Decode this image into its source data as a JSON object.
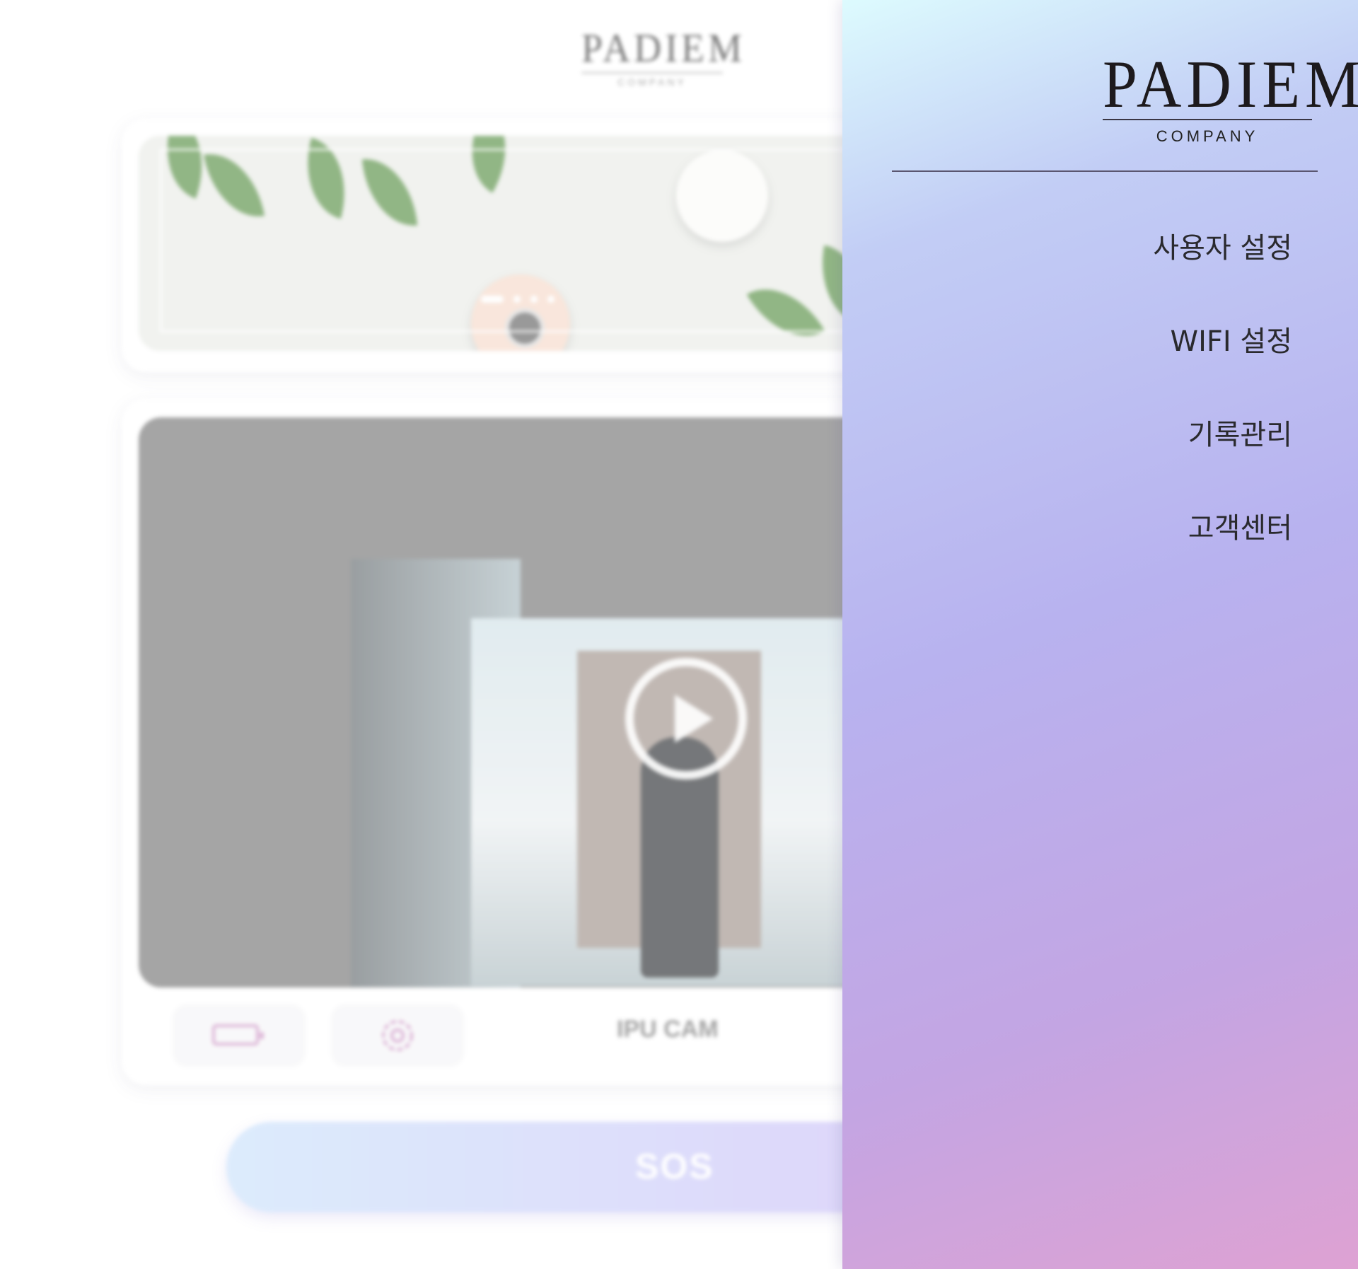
{
  "app": {
    "logo": {
      "name": "PADIEM",
      "subtitle": "COMPANY"
    },
    "banner": {
      "slides": 4,
      "active_slide": 1
    },
    "video": {
      "play_icon": "play-icon"
    },
    "controls": {
      "battery_icon": "battery-icon",
      "settings_icon": "gear-icon",
      "camera_name": "IPU CAM"
    },
    "sos_label": "SOS"
  },
  "drawer": {
    "logo": {
      "name": "PADIEM",
      "subtitle": "COMPANY"
    },
    "menu": [
      {
        "label": "사용자 설정"
      },
      {
        "label": "WIFI 설정"
      },
      {
        "label": "기록관리"
      },
      {
        "label": "고객센터"
      }
    ],
    "colors": {
      "gradient_top": "#ddfbfe",
      "gradient_mid": "#b8b2ef",
      "gradient_bottom": "#dea2d3"
    }
  }
}
